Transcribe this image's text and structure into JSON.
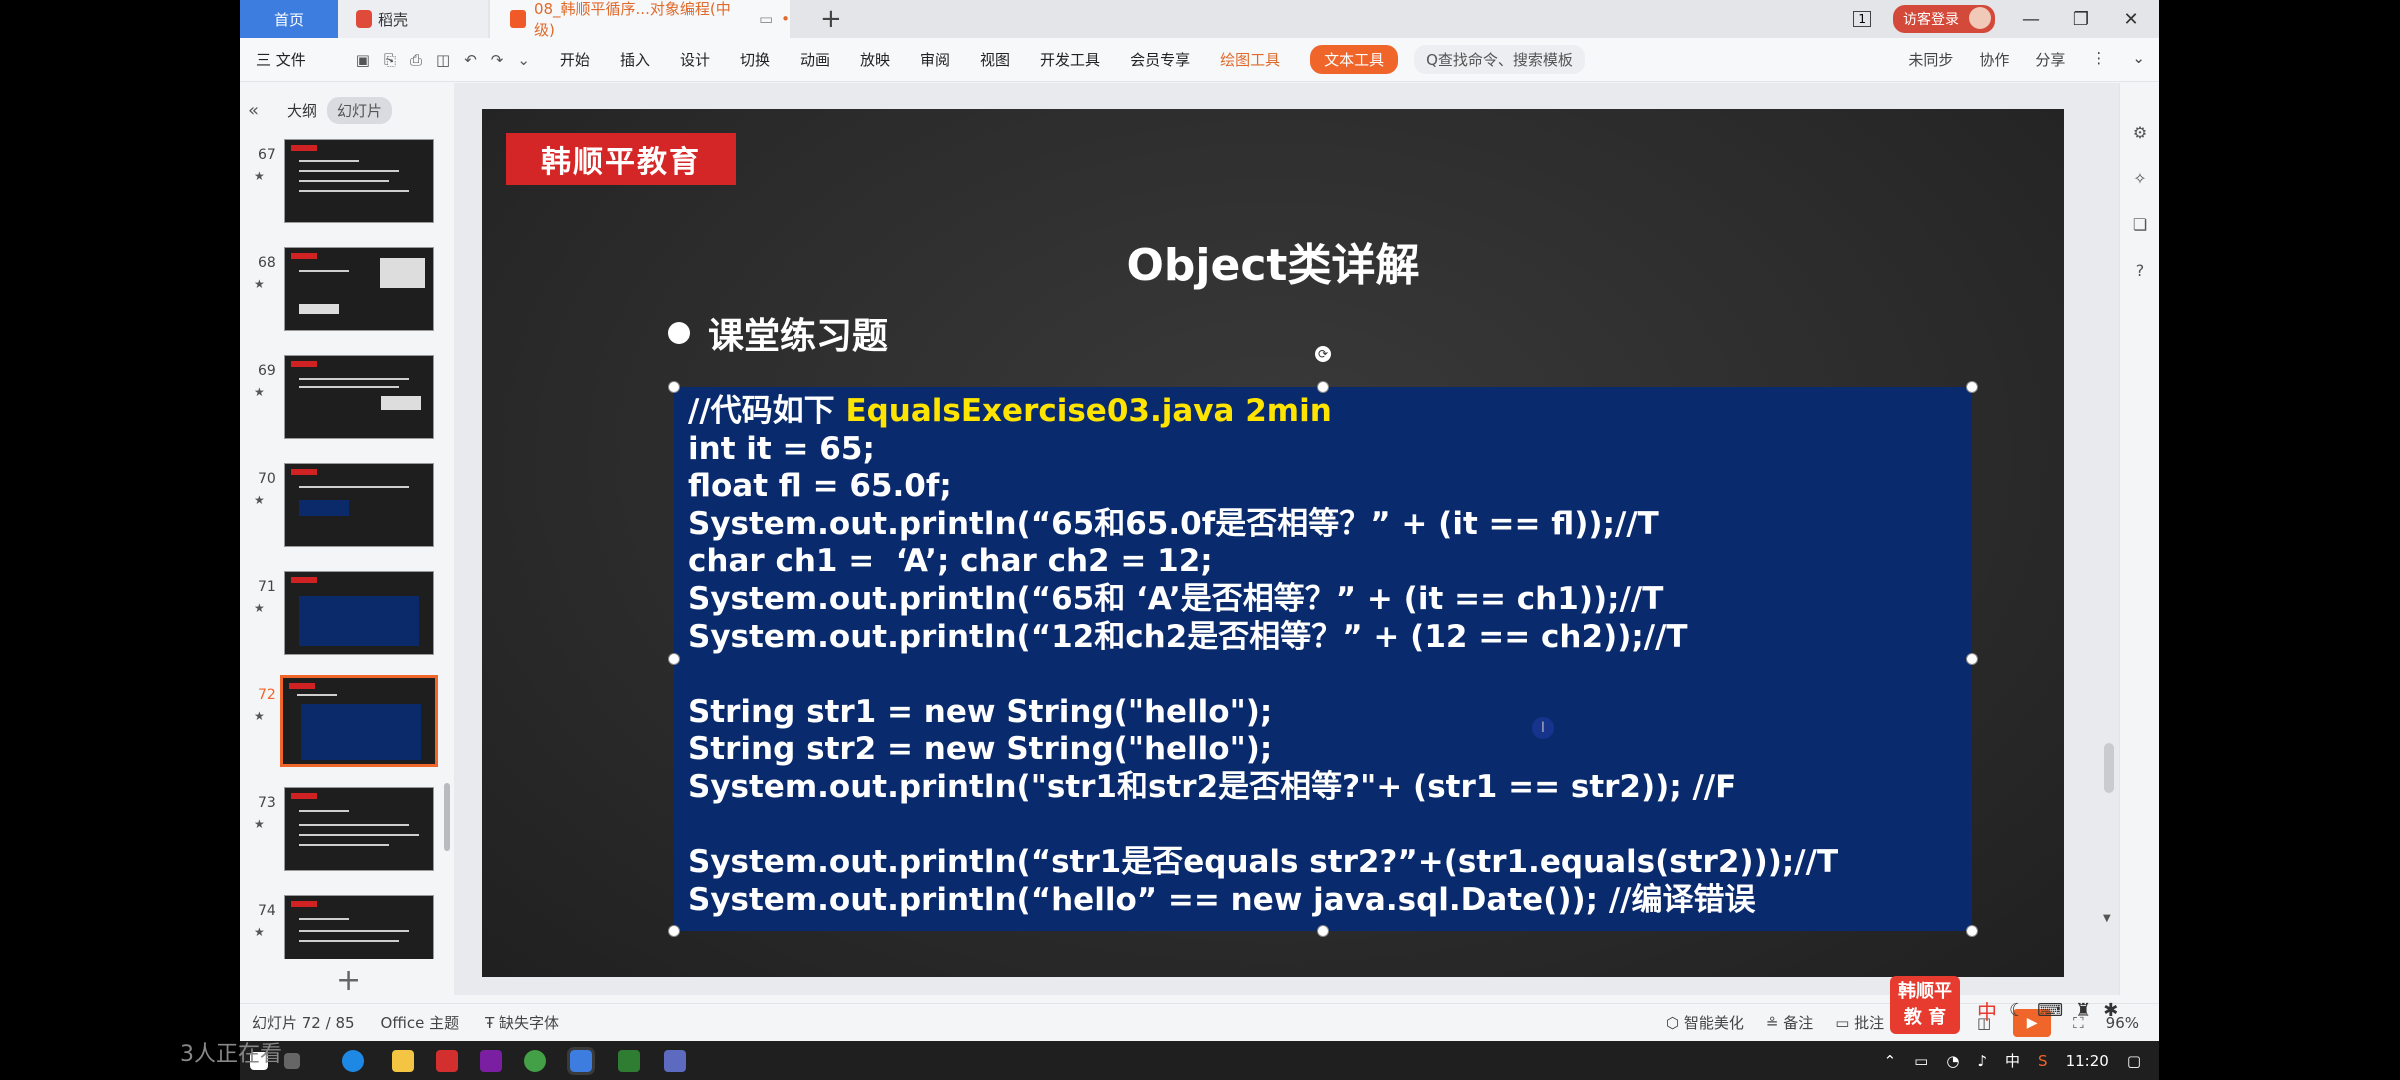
{
  "titlebar": {
    "tab_home": "首页",
    "tab_daoke": "稻壳",
    "tab_doc": "08_韩顺平循序...对象编程(中级)",
    "add_tab": "+",
    "window_num": "1",
    "login": "访客登录"
  },
  "ribbon": {
    "file": "三 文件",
    "menus": [
      "开始",
      "插入",
      "设计",
      "切换",
      "动画",
      "放映",
      "审阅",
      "视图",
      "开发工具",
      "会员专享"
    ],
    "draw_tools": "绘图工具",
    "text_tools": "文本工具",
    "search": "Q查找命令、搜索模板",
    "right": [
      "未同步",
      "协作",
      "分享"
    ]
  },
  "sidebar": {
    "tab_outline": "大纲",
    "tab_slides": "幻灯片",
    "thumbnails": [
      {
        "num": "67"
      },
      {
        "num": "68"
      },
      {
        "num": "69"
      },
      {
        "num": "70"
      },
      {
        "num": "71"
      },
      {
        "num": "72"
      },
      {
        "num": "73"
      },
      {
        "num": "74"
      }
    ],
    "add": "+"
  },
  "slide": {
    "logo": "韩顺平教育",
    "title": "Object类详解",
    "bullet": "课堂练习题",
    "code_lines": [
      {
        "text": "//代码如下 ",
        "highlight": "EqualsExercise03.java 2min"
      },
      {
        "text": "int it = 65;"
      },
      {
        "text": "float fl = 65.0f;"
      },
      {
        "text": "System.out.println(“65和65.0f是否相等？” + (it == fl));//T"
      },
      {
        "text": "char ch1 =  ‘A’; char ch2 = 12;"
      },
      {
        "text": "System.out.println(“65和 ‘A’是否相等？” + (it == ch1));//T"
      },
      {
        "text": "System.out.println(“12和ch2是否相等？” + (12 == ch2));//T"
      },
      {
        "text": ""
      },
      {
        "text": "String str1 = new String(\"hello\");"
      },
      {
        "text": "String str2 = new String(\"hello\");"
      },
      {
        "text": "System.out.println(\"str1和str2是否相等?\"+ (str1 == str2)); //F"
      },
      {
        "text": ""
      },
      {
        "text": "System.out.println(“str1是否equals str2?”+(str1.equals(str2)));//T"
      },
      {
        "text": "System.out.println(“hello” == new java.sql.Date()); //编译错误"
      }
    ]
  },
  "status": {
    "slide_count": "幻灯片 72 / 85",
    "theme": "Office 主题",
    "missing_font": "缺失字体",
    "beautify": "智能美化",
    "notes": "备注",
    "comments": "批注",
    "zoom": "96%"
  },
  "brand_badge": "韩顺平\n教 育",
  "ime": "中",
  "taskbar": {
    "time": "11:20",
    "ime": "中",
    "watching": "3人正在看"
  },
  "colors": {
    "accent": "#f06529",
    "code_bg": "#0a2a6e",
    "highlight": "#ffe400",
    "logo_red": "#d42626"
  }
}
